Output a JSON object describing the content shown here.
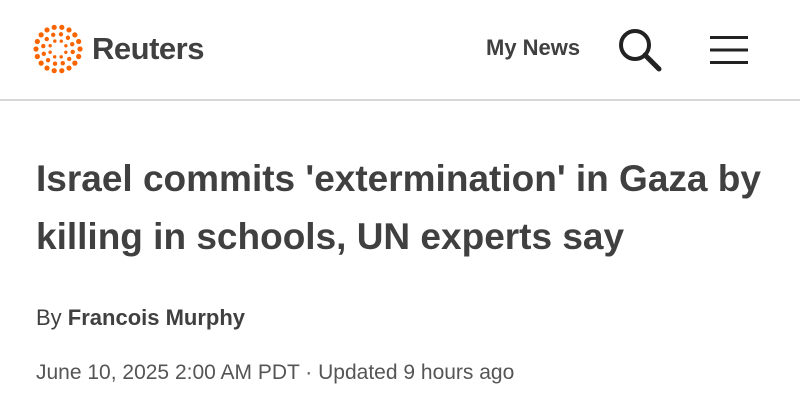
{
  "header": {
    "brand": "Reuters",
    "brand_color": "#fa6400",
    "my_news_label": "My News",
    "search_icon": "search-icon",
    "menu_icon": "hamburger-menu-icon"
  },
  "article": {
    "headline": "Israel commits 'extermination' in Gaza by killing in schools, UN experts say",
    "byline_prefix": "By ",
    "author": "Francois Murphy",
    "published": "June 10, 2025 2:00 AM PDT",
    "separator": " · ",
    "updated": "Updated 9 hours ago"
  }
}
